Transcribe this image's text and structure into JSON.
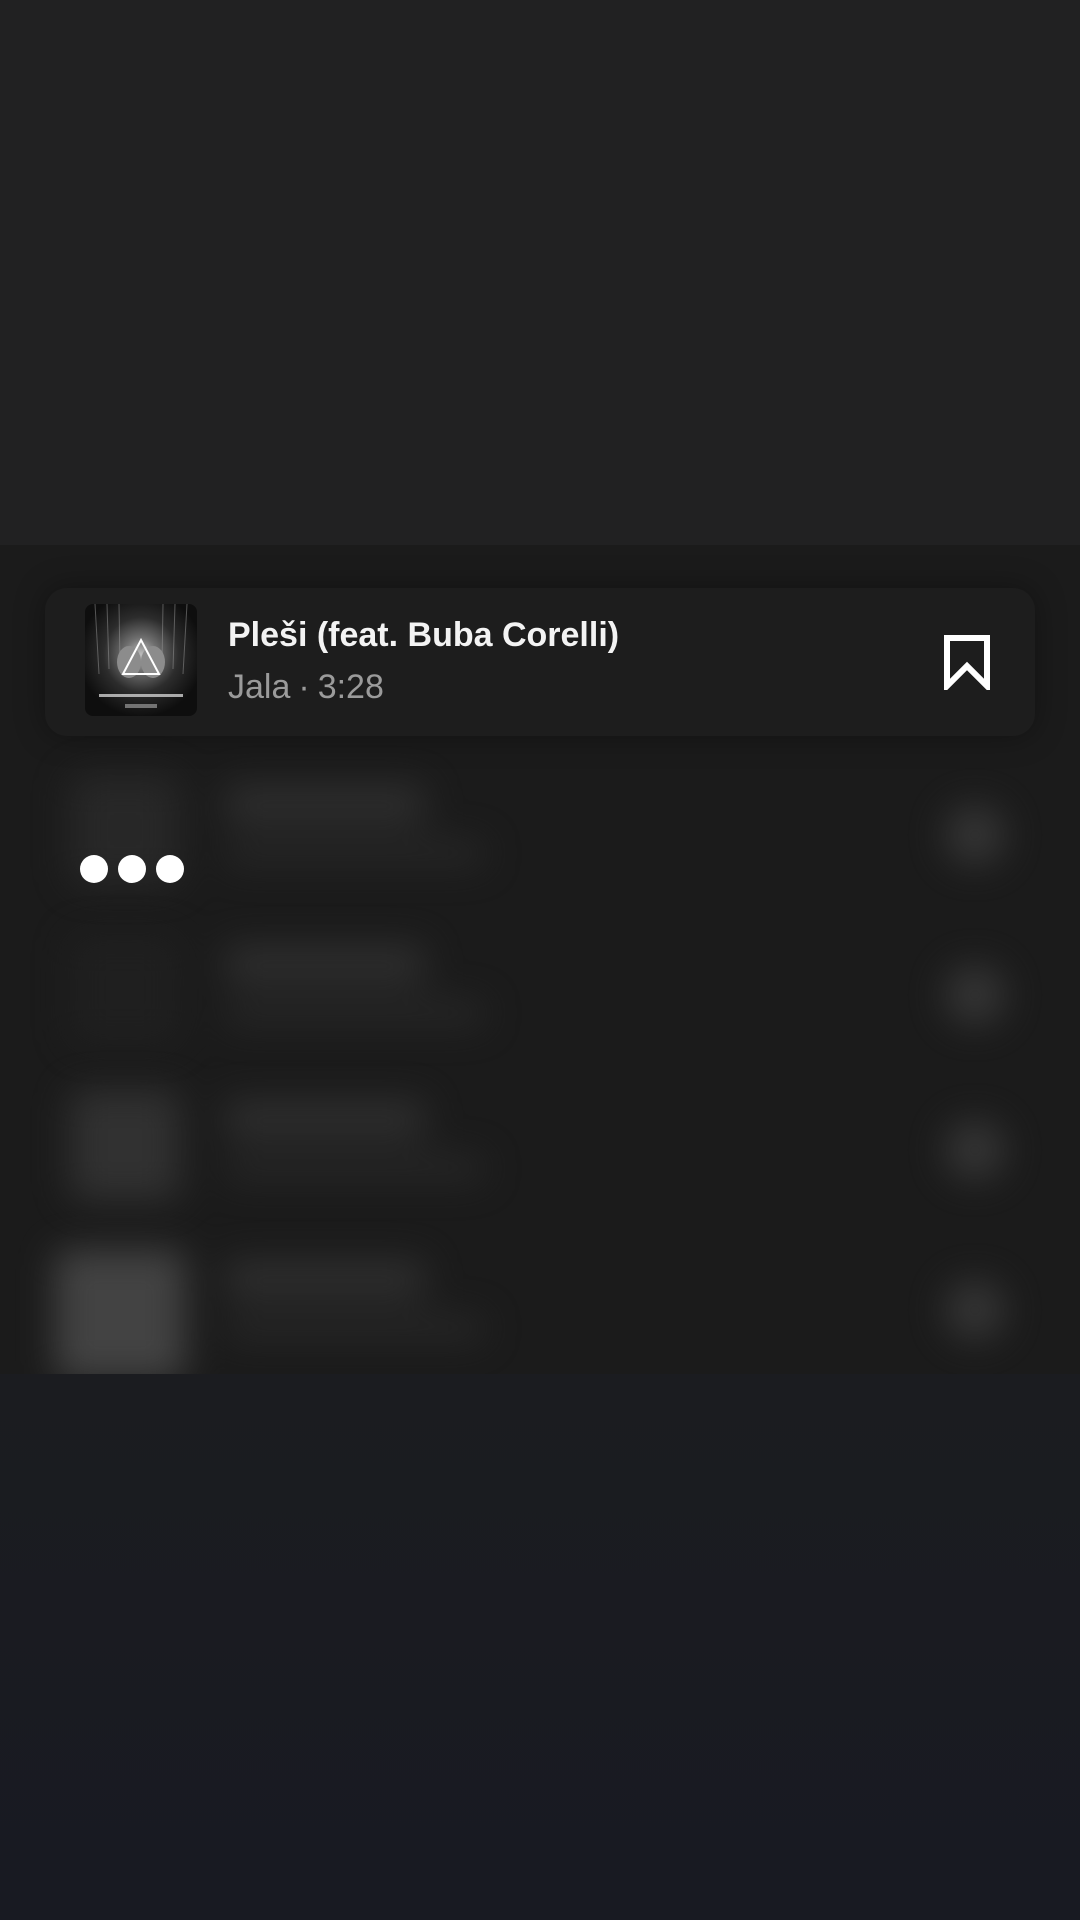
{
  "song": {
    "title": "Pleši (feat. Buba Corelli)",
    "artist": "Jala",
    "separator": "·",
    "duration": "3:28",
    "artwork_icon": "album-artwork",
    "action_icon": "bookmark-icon"
  },
  "indicator": {
    "icon": "ellipsis-typing-indicator",
    "dot_count": 3
  },
  "colors": {
    "title": "#f3f3f3",
    "meta": "#9b9b9b",
    "card": "#1d1d1d",
    "panel": "#1b1b1b",
    "backdrop": "#212122"
  }
}
